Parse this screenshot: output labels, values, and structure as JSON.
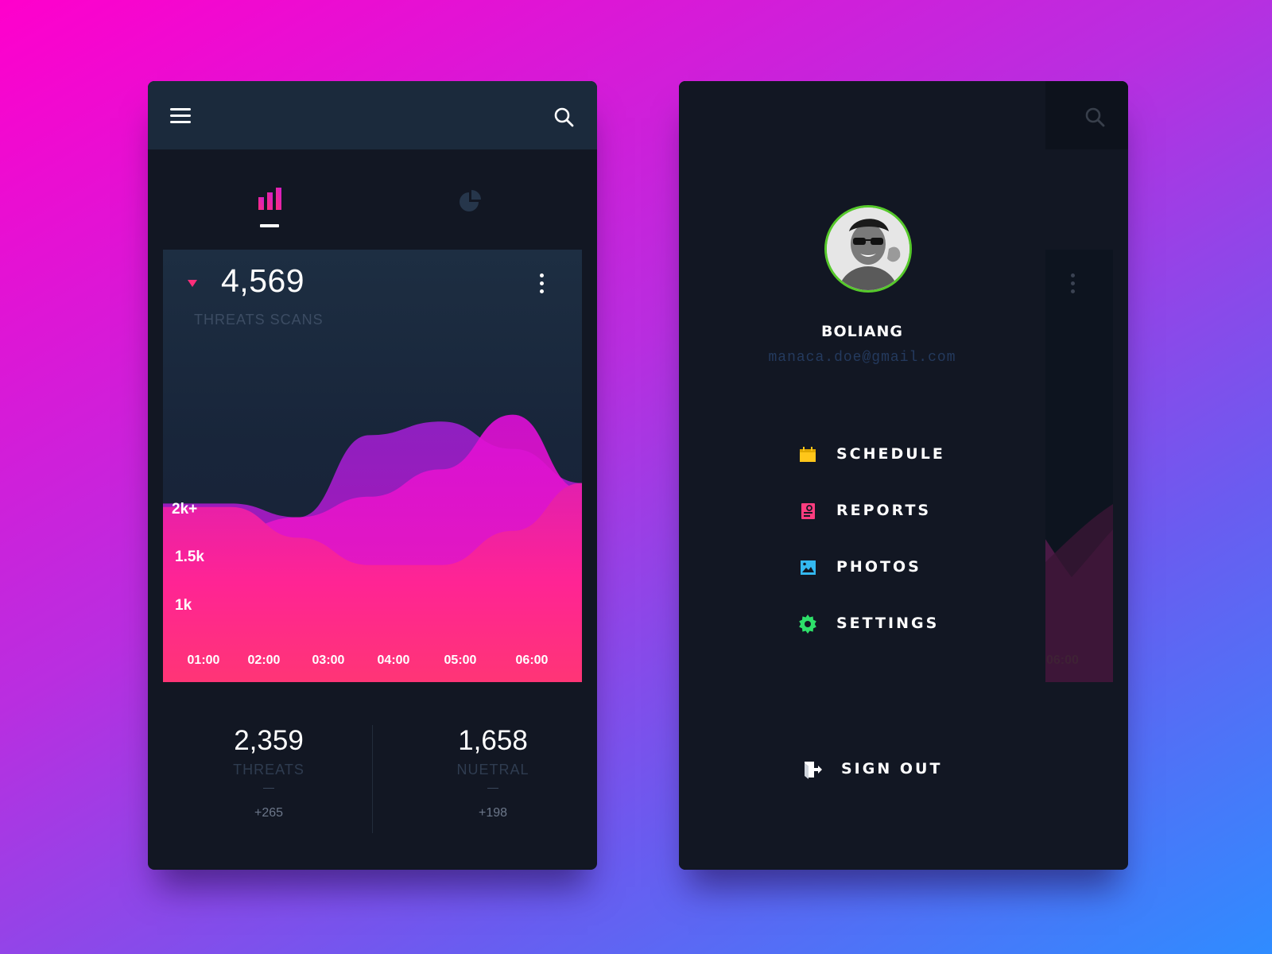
{
  "colors": {
    "accent": "#ff2e7a",
    "schedule_icon": "#ffc61a",
    "reports_icon": "#ff3d7f",
    "photos_icon": "#33b8f0",
    "settings_icon": "#2ee06a",
    "avatar_ring": "#56c92b"
  },
  "left_screen": {
    "tabs": [
      {
        "icon": "bar-chart-icon",
        "active": true
      },
      {
        "icon": "pie-chart-icon",
        "active": false
      }
    ],
    "chart_card": {
      "value": "4,569",
      "label": "THREATS SCANS",
      "trend_icon": "triangle-down-icon"
    },
    "stats": [
      {
        "value": "2,359",
        "label": "THREATS",
        "delta": "+265"
      },
      {
        "value": "1,658",
        "label": "NUETRAL",
        "delta": "+198"
      }
    ]
  },
  "chart_data": {
    "type": "area",
    "title": "",
    "xlabel": "",
    "ylabel": "",
    "categories": [
      "01:00",
      "02:00",
      "03:00",
      "04:00",
      "05:00",
      "06:00"
    ],
    "y_tick_labels": [
      "2k+",
      "1.5k",
      "1k"
    ],
    "series": [
      {
        "values": [
          2.1,
          1.9,
          3.1,
          3.3,
          2.9,
          2.4
        ]
      },
      {
        "values": [
          1.7,
          1.9,
          2.2,
          2.6,
          3.4,
          2.3
        ]
      },
      {
        "values": [
          2.05,
          1.6,
          1.2,
          1.2,
          1.7,
          2.4
        ]
      }
    ],
    "grid": false,
    "legend": "none"
  },
  "right_screen": {
    "user": {
      "name": "BOLIANG",
      "email": "manaca.doe@gmail.com"
    },
    "menu": [
      {
        "label": "SCHEDULE",
        "icon": "calendar-icon"
      },
      {
        "label": "REPORTS",
        "icon": "report-icon"
      },
      {
        "label": "PHOTOS",
        "icon": "image-icon"
      },
      {
        "label": "SETTINGS",
        "icon": "gear-icon"
      }
    ],
    "sign_out": {
      "label": "SIGN OUT",
      "icon": "sign-out-icon"
    },
    "background_x_label": "06:00"
  }
}
